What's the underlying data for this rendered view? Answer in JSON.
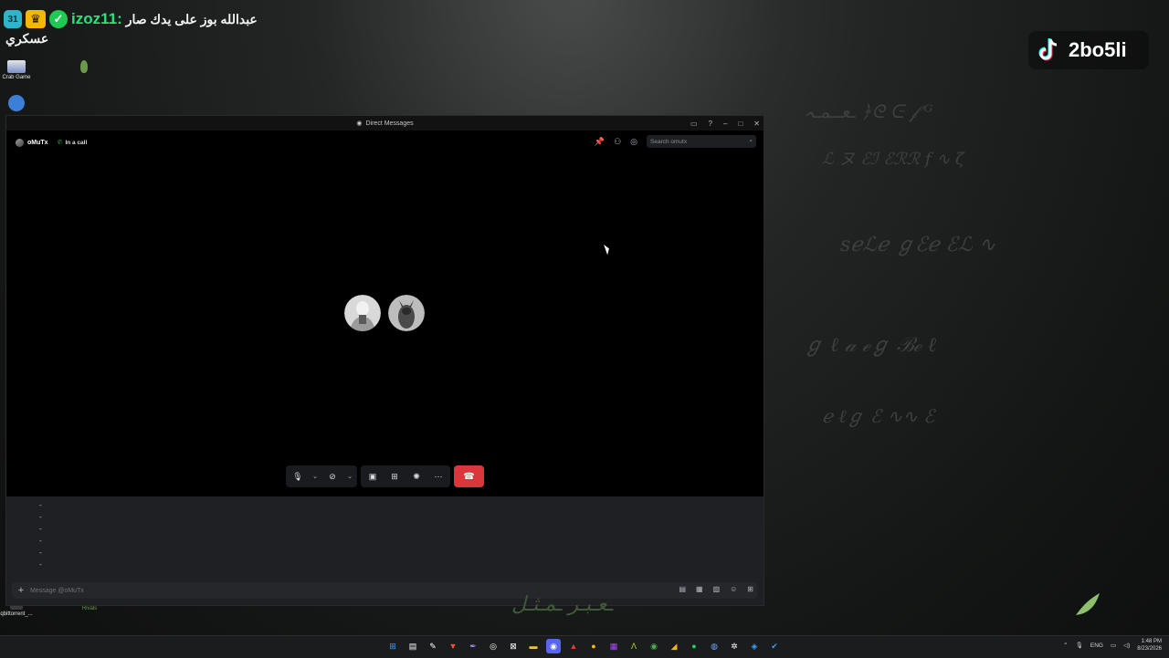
{
  "stream_chat": {
    "sub_months": "31",
    "username": "izoz11:",
    "message_line1": "عبدالله بوز على يدك صار",
    "message_line2": "عسكري"
  },
  "desktop": {
    "icons": [
      {
        "label": "Crab Game"
      },
      {
        "label": "qbittorrent_..."
      },
      {
        "label": "Rivals"
      }
    ]
  },
  "tiktok": {
    "handle": "2bo5li"
  },
  "window": {
    "title": "Direct Messages",
    "dm_header": {
      "username": "oMuTx",
      "status": "In a call",
      "search_placeholder": "Search omutx"
    },
    "message_placeholder": "Message @oMuTx",
    "chat_dashes": [
      "-",
      "-",
      "-",
      "-",
      "-",
      "-"
    ]
  },
  "taskbar": {
    "language": "ENG",
    "time": "1:48 PM",
    "date": "8/23/2026"
  },
  "colors": {
    "hangup": "#da373c",
    "in_call_green": "#23a55a",
    "chat_username": "#2ee07c"
  }
}
